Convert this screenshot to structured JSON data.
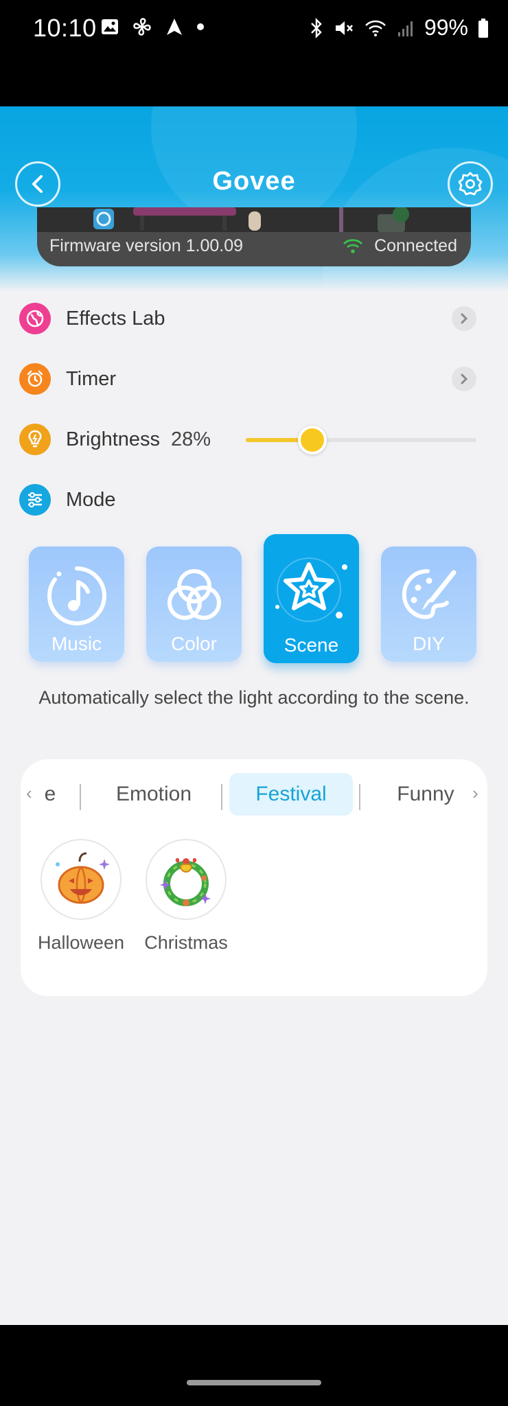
{
  "status_bar": {
    "time": "10:10",
    "battery": "99%"
  },
  "header": {
    "logo": "Govee"
  },
  "device": {
    "firmware": "Firmware version 1.00.09",
    "connection": "Connected"
  },
  "rows": {
    "effects_lab": "Effects Lab",
    "timer": "Timer",
    "brightness": "Brightness",
    "brightness_value": "28%",
    "brightness_level": 0.29,
    "mode": "Mode"
  },
  "modes": [
    {
      "label": "Music",
      "icon": "music-note-icon"
    },
    {
      "label": "Color",
      "icon": "color-circles-icon"
    },
    {
      "label": "Scene",
      "icon": "star-icon",
      "active": true
    },
    {
      "label": "DIY",
      "icon": "palette-brush-icon"
    }
  ],
  "mode_description": "Automatically select the light according to the scene.",
  "scene_tabs": [
    {
      "label": "e",
      "partial": true
    },
    {
      "label": "Emotion"
    },
    {
      "label": "Festival",
      "active": true
    },
    {
      "label": "Funny"
    }
  ],
  "scenes": [
    {
      "label": "Halloween",
      "icon": "pumpkin-icon"
    },
    {
      "label": "Christmas",
      "icon": "wreath-icon"
    }
  ],
  "colors": {
    "header": "#08a5e2",
    "accent": "#0aa6ea",
    "effects_icon": "#ee3f92",
    "timer_icon": "#f7851d",
    "brightness_icon": "#f0a21a",
    "mode_icon": "#16a6e0",
    "slider": "#f3c62b"
  }
}
